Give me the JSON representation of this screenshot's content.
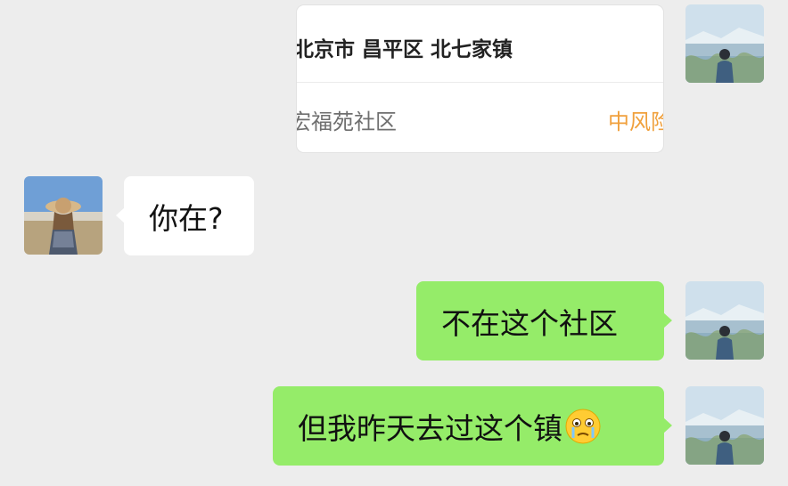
{
  "location_card": {
    "title": "北京市 昌平区 北七家镇",
    "community": "宏福苑社区",
    "risk_level": "中风险"
  },
  "messages": [
    {
      "side": "left",
      "text": "你在?"
    },
    {
      "side": "right",
      "text": "不在这个社区"
    },
    {
      "side": "right",
      "text": "但我昨天去过这个镇",
      "emoji": "crying-face-emoji"
    }
  ],
  "colors": {
    "background": "#ededed",
    "own_bubble": "#95ec69",
    "other_bubble": "#ffffff",
    "risk_text": "#f0a03c"
  }
}
